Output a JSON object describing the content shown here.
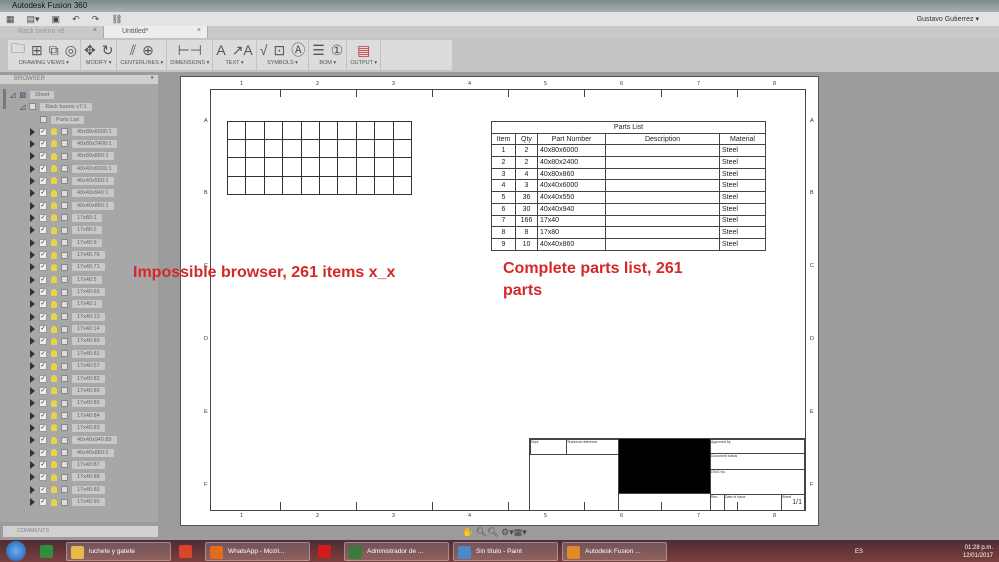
{
  "app": {
    "title": "Autodesk Fusion 360",
    "user": "Gustavo Gutierrez"
  },
  "tabs": [
    {
      "label": "Rack bueno v8",
      "active": false
    },
    {
      "label": "Untitled*",
      "active": true
    }
  ],
  "ribbon": [
    {
      "label": "DRAWING VIEWS ▾",
      "icons": [
        "folder-icon",
        "base-view-icon",
        "projected-view-icon",
        "detail-view-icon"
      ]
    },
    {
      "label": "MODIFY ▾",
      "icons": [
        "move-icon",
        "rotate-icon"
      ]
    },
    {
      "label": "CENTERLINES ▾",
      "icons": [
        "centerline-icon",
        "center-mark-icon"
      ]
    },
    {
      "label": "DIMENSIONS ▾",
      "icons": [
        "dimension-icon"
      ]
    },
    {
      "label": "TEXT ▾",
      "icons": [
        "text-icon",
        "leader-text-icon"
      ]
    },
    {
      "label": "SYMBOLS ▾",
      "icons": [
        "surface-texture-icon",
        "feature-control-frame-icon",
        "datum-icon"
      ]
    },
    {
      "label": "BOM ▾",
      "icons": [
        "table-icon",
        "balloon-icon"
      ]
    },
    {
      "label": "OUTPUT ▾",
      "icons": [
        "pdf-icon"
      ]
    }
  ],
  "browser": {
    "title": "BROWSER",
    "sheet": "Sheet",
    "component": "Rack bueno v7:1",
    "parts_list": "Parts List",
    "items": [
      "40x80x6000:1",
      "40x80x2400:1",
      "40x80x860:1",
      "40x40x6000:1",
      "40x40x550:1",
      "40x40x940:1",
      "40x40x860:1",
      "17x80:1",
      "17x80:2",
      "17x40:9",
      "17x40:76",
      "17x40:71",
      "17x40:5",
      "17x40:66",
      "17x40:1",
      "17x40:13",
      "17x40:14",
      "17x40:80",
      "17x40:81",
      "17x40:57",
      "17x40:82",
      "17x40:86",
      "17x40:85",
      "17x40:84",
      "17x40:83",
      "40x40x940:89",
      "40x40x860:2",
      "17x40:87",
      "17x40:88",
      "17x40:89",
      "17x40:90"
    ]
  },
  "comments": {
    "title": "COMMENTS"
  },
  "sheet": {
    "columns": [
      "1",
      "2",
      "3",
      "4",
      "5",
      "6",
      "7",
      "8"
    ],
    "rows": [
      "A",
      "B",
      "C",
      "D",
      "E",
      "F"
    ],
    "parts_list": {
      "title": "Parts List",
      "headers": [
        "Item",
        "Qty",
        "Part Number",
        "Description",
        "Material"
      ],
      "rows": [
        [
          "1",
          "2",
          "40x80x6000",
          "",
          "Steel"
        ],
        [
          "2",
          "2",
          "40x80x2400",
          "",
          "Steel"
        ],
        [
          "3",
          "4",
          "40x80x860",
          "",
          "Steel"
        ],
        [
          "4",
          "3",
          "40x40x6000",
          "",
          "Steel"
        ],
        [
          "5",
          "36",
          "40x40x550",
          "",
          "Steel"
        ],
        [
          "6",
          "30",
          "40x40x940",
          "",
          "Steel"
        ],
        [
          "7",
          "166",
          "17x40",
          "",
          "Steel"
        ],
        [
          "8",
          "8",
          "17x80",
          "",
          "Steel"
        ],
        [
          "9",
          "10",
          "40x40x860",
          "",
          "Steel"
        ]
      ]
    },
    "title_block": {
      "dept": "Dept.",
      "tech_ref": "Technical reference",
      "approved": "Approved by",
      "doc_status": "Document status",
      "dwg_no": "DWG No.",
      "rev": "Rev.",
      "date": "Date of issue",
      "sheet_label": "Sheet",
      "sheet_value": "1/1"
    }
  },
  "annotations": {
    "left": "Impossible browser, 261 items x_x",
    "right": "Complete parts list, 261 parts"
  },
  "taskbar": {
    "items": [
      {
        "label": "",
        "icon": "excel-icon",
        "color": "#2f8f3f"
      },
      {
        "label": "luchete y gatete",
        "icon": "folder-icon",
        "color": "#e5b94a"
      },
      {
        "label": "",
        "icon": "chrome-icon",
        "color": "#d9442c"
      },
      {
        "label": "WhatsApp - Mozil...",
        "icon": "firefox-icon",
        "color": "#e36b1e"
      },
      {
        "label": "",
        "icon": "opera-icon",
        "color": "#d01c1c"
      },
      {
        "label": "Administrador de ...",
        "icon": "task-manager-icon",
        "color": "#3a7a3a"
      },
      {
        "label": "Sin título - Paint",
        "icon": "paint-icon",
        "color": "#4a8ac8"
      },
      {
        "label": "Autodesk Fusion ...",
        "icon": "fusion-icon",
        "color": "#e08a2a"
      }
    ],
    "lang": "ES",
    "time": "01:28 p.m.",
    "date": "12/01/2017"
  }
}
